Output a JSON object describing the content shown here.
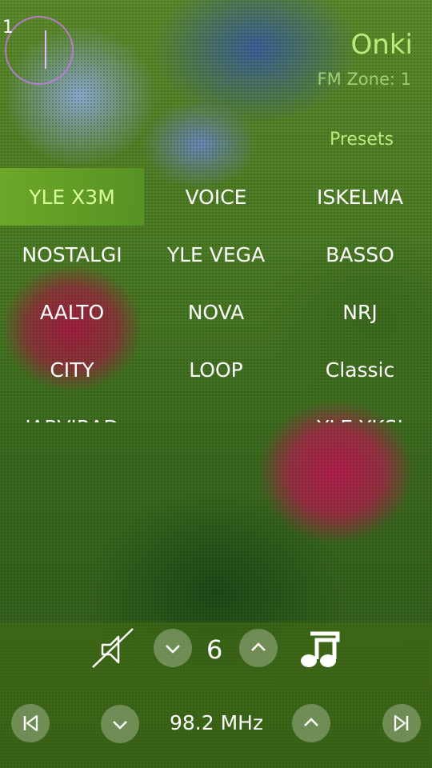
{
  "status": {
    "clock_number": "1"
  },
  "app": {
    "title": "Onki",
    "zone": "FM Zone: 1"
  },
  "presets": {
    "header": "Presets",
    "items": [
      {
        "label": "YLE X3M",
        "active": true
      },
      {
        "label": "VOICE"
      },
      {
        "label": "ISKELMA"
      },
      {
        "label": "NOSTALGI"
      },
      {
        "label": "YLE VEGA"
      },
      {
        "label": "BASSO"
      },
      {
        "label": "AALTO"
      },
      {
        "label": "NOVA"
      },
      {
        "label": "NRJ"
      },
      {
        "label": "CITY"
      },
      {
        "label": "LOOP"
      },
      {
        "label": "Classic"
      },
      {
        "label": "JARVIRAD"
      },
      {
        "label": ""
      },
      {
        "label": "YLE YKSI"
      }
    ]
  },
  "controls": {
    "volume": "6",
    "frequency": "98.2 MHz",
    "icons": {
      "mute": "mute-icon",
      "volume_down": "chevron-down-icon",
      "volume_up": "chevron-up-icon",
      "music": "music-note-icon",
      "prev": "skip-previous-icon",
      "tune_down": "chevron-down-icon",
      "tune_up": "chevron-up-icon",
      "next": "skip-next-icon"
    }
  },
  "colors": {
    "accent": "#b7ec7a",
    "active_bg": "#6eaa28",
    "clock_ring": "#c878e6"
  }
}
